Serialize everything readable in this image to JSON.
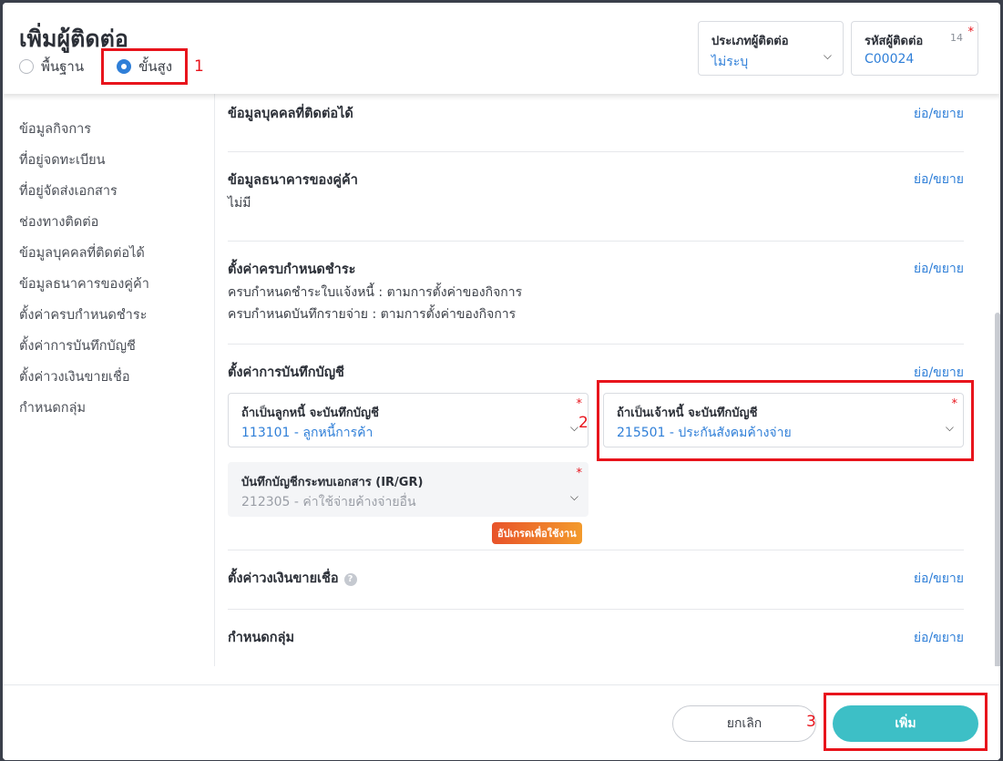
{
  "header": {
    "title": "เพิ่มผู้ติดต่อ",
    "mode_basic": "พื้นฐาน",
    "mode_advanced": "ขั้นสูง",
    "contact_type_label": "ประเภทผู้ติดต่อ",
    "contact_type_value": "ไม่ระบุ",
    "contact_code_label": "รหัสผู้ติดต่อ",
    "contact_code_value": "C00024",
    "contact_code_count": "14",
    "required_mark": "*"
  },
  "annotations": {
    "a1": "1",
    "a2": "2",
    "a3": "3"
  },
  "sidebar": {
    "items": [
      {
        "label": "ข้อมูลกิจการ"
      },
      {
        "label": "ที่อยู่จดทะเบียน"
      },
      {
        "label": "ที่อยู่จัดส่งเอกสาร"
      },
      {
        "label": "ช่องทางติดต่อ"
      },
      {
        "label": "ข้อมูลบุคคลที่ติดต่อได้"
      },
      {
        "label": "ข้อมูลธนาคารของคู่ค้า"
      },
      {
        "label": "ตั้งค่าครบกำหนดชำระ"
      },
      {
        "label": "ตั้งค่าการบันทึกบัญชี"
      },
      {
        "label": "ตั้งค่าวงเงินขายเชื่อ"
      },
      {
        "label": "กำหนดกลุ่ม"
      }
    ]
  },
  "content": {
    "toggle_label": "ย่อ/ขยาย",
    "contact_person": {
      "title": "ข้อมูลบุคคลที่ติดต่อได้"
    },
    "bank": {
      "title": "ข้อมูลธนาคารของคู่ค้า",
      "value": "ไม่มี"
    },
    "due": {
      "title": "ตั้งค่าครบกำหนดชำระ",
      "line1": "ครบกำหนดชำระใบแจ้งหนี้ : ตามการตั้งค่าของกิจการ",
      "line2": "ครบกำหนดบันทึกรายจ่าย : ตามการตั้งค่าของกิจการ"
    },
    "accounting": {
      "title": "ตั้งค่าการบันทึกบัญชี",
      "debtor_label": "ถ้าเป็นลูกหนี้ จะบันทึกบัญชี",
      "debtor_value": "113101 - ลูกหนี้การค้า",
      "creditor_label": "ถ้าเป็นเจ้าหนี้ จะบันทึกบัญชี",
      "creditor_value": "215501 - ประกันสังคมค้างจ่าย",
      "irgr_label": "บันทึกบัญชีกระทบเอกสาร (IR/GR)",
      "irgr_value": "212305 - ค่าใช้จ่ายค้างจ่ายอื่น",
      "upgrade_badge": "อัปเกรดเพื่อใช้งาน"
    },
    "credit": {
      "title": "ตั้งค่าวงเงินขายเชื่อ",
      "help": "?"
    },
    "group": {
      "title": "กำหนดกลุ่ม"
    }
  },
  "footer": {
    "cancel_label": "ยกเลิก",
    "add_label": "เพิ่ม"
  }
}
